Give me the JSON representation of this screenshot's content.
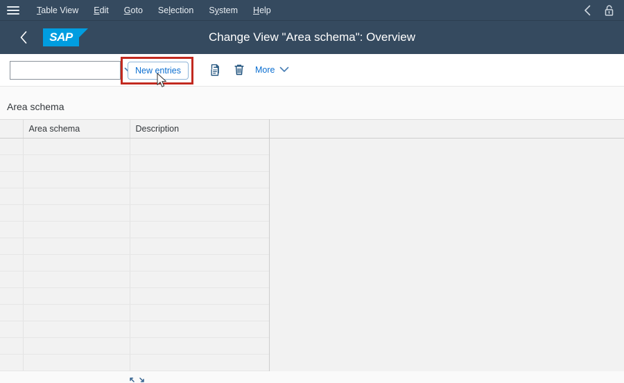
{
  "menubar": {
    "menu_icon": "hamburger-icon",
    "items": [
      {
        "label": "Table View",
        "accel": "T"
      },
      {
        "label": "Edit",
        "accel": "E"
      },
      {
        "label": "Goto",
        "accel": "G"
      },
      {
        "label": "Selection",
        "accel": "l"
      },
      {
        "label": "System",
        "accel": "y"
      },
      {
        "label": "Help",
        "accel": "H"
      }
    ],
    "right_icons": [
      {
        "name": "back-chevron-icon"
      },
      {
        "name": "lock-icon"
      }
    ]
  },
  "shellbar": {
    "back_icon": "back-arrow-icon",
    "logo_text": "SAP",
    "title": "Change View \"Area schema\": Overview"
  },
  "toolbar": {
    "combo": {
      "value": "",
      "placeholder": "",
      "arrow_icon": "chevron-down-icon"
    },
    "new_entries_label": "New entries",
    "copy_icon": "copy-icon",
    "delete_icon": "trash-icon",
    "more_label": "More",
    "more_arrow_icon": "chevron-down-icon",
    "highlight_color": "#c2291f"
  },
  "content": {
    "section_title": "Area schema",
    "table": {
      "columns": [
        "",
        "Area schema",
        "Description",
        ""
      ],
      "rows": [
        [
          "",
          "",
          "",
          ""
        ],
        [
          "",
          "",
          "",
          ""
        ],
        [
          "",
          "",
          "",
          ""
        ],
        [
          "",
          "",
          "",
          ""
        ],
        [
          "",
          "",
          "",
          ""
        ],
        [
          "",
          "",
          "",
          ""
        ],
        [
          "",
          "",
          "",
          ""
        ],
        [
          "",
          "",
          "",
          ""
        ],
        [
          "",
          "",
          "",
          ""
        ],
        [
          "",
          "",
          "",
          ""
        ],
        [
          "",
          "",
          "",
          ""
        ],
        [
          "",
          "",
          "",
          ""
        ],
        [
          "",
          "",
          "",
          ""
        ],
        [
          "",
          "",
          "",
          ""
        ]
      ]
    }
  },
  "colors": {
    "shell_bg": "#354a5f",
    "sap_blue": "#009de0",
    "accent_link": "#0a6ed1",
    "table_bg": "#f2f2f2"
  }
}
